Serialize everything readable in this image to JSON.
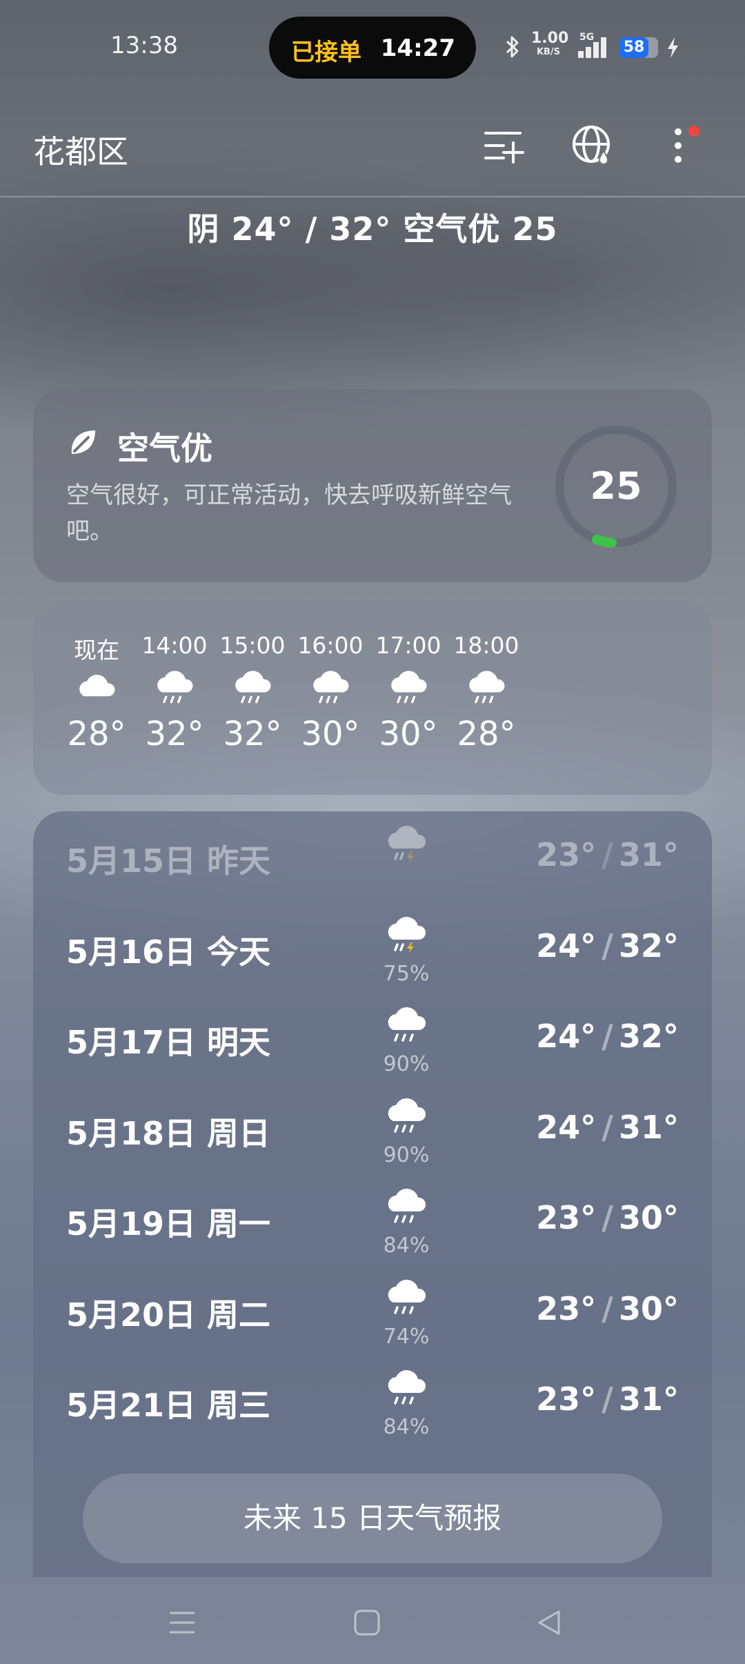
{
  "status_bar": {
    "time": "13:38",
    "pill_label": "已接单",
    "pill_time": "14:27",
    "net_speed": "1.00",
    "net_unit": "KB/S",
    "network_type": "5G",
    "battery": "58"
  },
  "header": {
    "city": "花都区",
    "icons": [
      "manage-cities-icon",
      "globe-icon",
      "more-icon"
    ]
  },
  "summary": "阴  24° / 32°  空气优 25",
  "aqi": {
    "title": "空气优",
    "description": "空气很好，可正常活动，快去呼吸新鲜空气吧。",
    "value": "25",
    "accent": "#3ec24a"
  },
  "hourly": [
    {
      "time": "现在",
      "icon": "cloud-icon",
      "temp": "28°"
    },
    {
      "time": "14:00",
      "icon": "rain-icon",
      "temp": "32°"
    },
    {
      "time": "15:00",
      "icon": "rain-icon",
      "temp": "32°"
    },
    {
      "time": "16:00",
      "icon": "rain-icon",
      "temp": "30°"
    },
    {
      "time": "17:00",
      "icon": "rain-icon",
      "temp": "30°"
    },
    {
      "time": "18:00",
      "icon": "rain-icon",
      "temp": "28°"
    }
  ],
  "daily": [
    {
      "date": "5月15日  昨天",
      "icon": "thunderstorm-icon",
      "pop": "",
      "low": "23°",
      "high": "31°"
    },
    {
      "date": "5月16日  今天",
      "icon": "thunderstorm-icon",
      "pop": "75%",
      "low": "24°",
      "high": "32°"
    },
    {
      "date": "5月17日  明天",
      "icon": "rain-icon",
      "pop": "90%",
      "low": "24°",
      "high": "32°"
    },
    {
      "date": "5月18日  周日",
      "icon": "rain-icon",
      "pop": "90%",
      "low": "24°",
      "high": "31°"
    },
    {
      "date": "5月19日  周一",
      "icon": "rain-icon",
      "pop": "84%",
      "low": "23°",
      "high": "30°"
    },
    {
      "date": "5月20日  周二",
      "icon": "rain-icon",
      "pop": "74%",
      "low": "23°",
      "high": "30°"
    },
    {
      "date": "5月21日  周三",
      "icon": "rain-icon",
      "pop": "84%",
      "low": "23°",
      "high": "31°"
    }
  ],
  "forecast_button": "未来 15 日天气预报",
  "nav": [
    "menu-icon",
    "home-icon",
    "back-icon"
  ]
}
